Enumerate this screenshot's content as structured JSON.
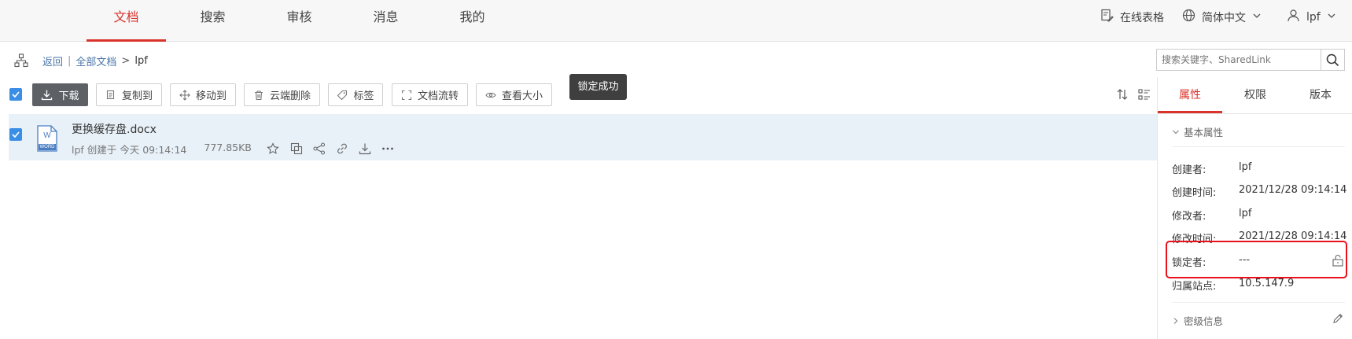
{
  "nav": {
    "tabs": [
      {
        "label": "文档",
        "active": true
      },
      {
        "label": "搜索",
        "active": false
      },
      {
        "label": "审核",
        "active": false
      },
      {
        "label": "消息",
        "active": false
      },
      {
        "label": "我的",
        "active": false
      }
    ],
    "online_sheet": "在线表格",
    "language": "简体中文",
    "user": "lpf"
  },
  "breadcrumb": {
    "back": "返回",
    "divider": "|",
    "all_docs": "全部文档",
    "arrow": ">",
    "current": "lpf"
  },
  "search": {
    "placeholder": "搜索关键字、SharedLink"
  },
  "toolbar": {
    "download": "下载",
    "copy_to": "复制到",
    "move_to": "移动到",
    "cloud_delete": "云端删除",
    "tags": "标签",
    "doc_flow": "文档流转",
    "view_size": "查看大小",
    "tooltip": "锁定成功"
  },
  "file": {
    "name": "更换缓存盘.docx",
    "creator_info": "lpf 创建于 今天 09:14:14",
    "size": "777.85KB",
    "icon_text": "W",
    "icon_label": "WORD"
  },
  "panel": {
    "tabs": [
      {
        "label": "属性",
        "active": true
      },
      {
        "label": "权限",
        "active": false
      },
      {
        "label": "版本",
        "active": false
      }
    ],
    "basic_section": "基本属性",
    "secret_section": "密级信息",
    "props": [
      {
        "label": "创建者:",
        "value": "lpf"
      },
      {
        "label": "创建时间:",
        "value": "2021/12/28 09:14:14"
      },
      {
        "label": "修改者:",
        "value": "lpf"
      },
      {
        "label": "修改时间:",
        "value": "2021/12/28 09:14:14"
      },
      {
        "label": "锁定者:",
        "value": "---"
      },
      {
        "label": "归属站点:",
        "value": "10.5.147.9"
      }
    ]
  },
  "colors": {
    "accent_red": "#d9332b",
    "checkbox_blue": "#3a8ee6",
    "row_highlight": "#e8f1f8",
    "primary_button": "#5d6166",
    "callout_red": "#e8121d"
  }
}
